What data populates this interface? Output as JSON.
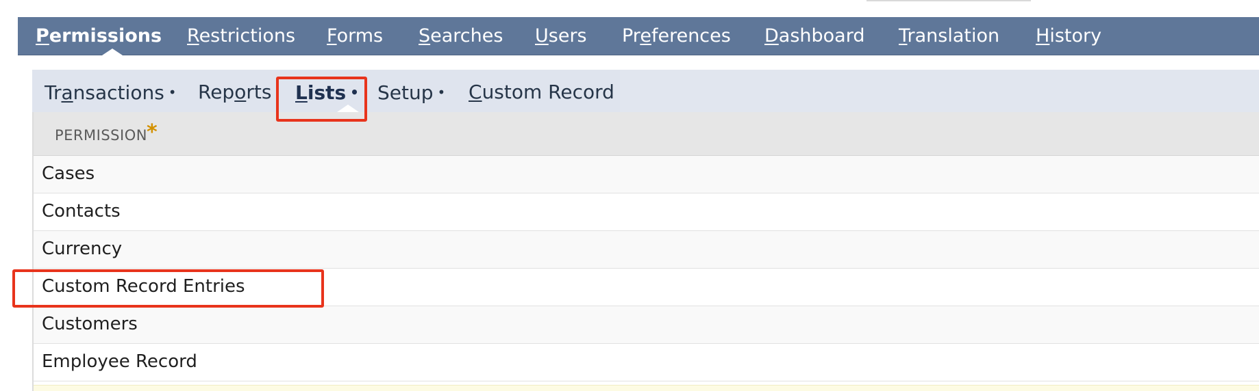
{
  "top_nav": {
    "items": [
      {
        "pre": "",
        "key": "P",
        "post": "ermissions",
        "active": true
      },
      {
        "pre": "",
        "key": "R",
        "post": "estrictions",
        "active": false
      },
      {
        "pre": "",
        "key": "F",
        "post": "orms",
        "active": false
      },
      {
        "pre": "",
        "key": "S",
        "post": "earches",
        "active": false
      },
      {
        "pre": "",
        "key": "U",
        "post": "sers",
        "active": false
      },
      {
        "pre": "Pr",
        "key": "e",
        "post": "ferences",
        "active": false
      },
      {
        "pre": "",
        "key": "D",
        "post": "ashboard",
        "active": false
      },
      {
        "pre": "",
        "key": "T",
        "post": "ranslation",
        "active": false
      },
      {
        "pre": "",
        "key": "H",
        "post": "istory",
        "active": false
      }
    ]
  },
  "sub_nav": {
    "items": [
      {
        "pre": "Tr",
        "key": "a",
        "post": "nsactions",
        "dot": "•",
        "active": false
      },
      {
        "pre": "Rep",
        "key": "o",
        "post": "rts",
        "dot": "",
        "active": false
      },
      {
        "pre": "",
        "key": "L",
        "post": "ists",
        "dot": "•",
        "active": true
      },
      {
        "pre": "Setup",
        "key": "",
        "post": "",
        "dot": "•",
        "active": false
      },
      {
        "pre": "",
        "key": "C",
        "post": "ustom Record",
        "dot": "",
        "active": false
      }
    ]
  },
  "table": {
    "header": "PERMISSION",
    "required_marker": "*",
    "rows": [
      "Cases",
      "Contacts",
      "Currency",
      "Custom Record Entries",
      "Customers",
      "Employee Record"
    ]
  },
  "colors": {
    "top_nav_bg": "#5f7799",
    "sub_nav_bg": "#e1e6ef",
    "highlight": "#e8341c",
    "required_star": "#d39100"
  }
}
